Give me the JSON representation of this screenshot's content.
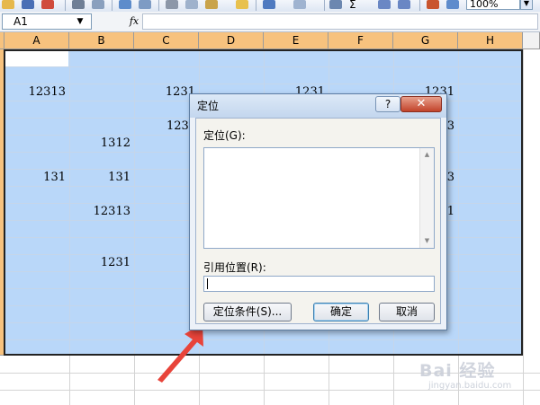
{
  "toolbar": {
    "zoom_value": "100%",
    "sigma_label": "Σ"
  },
  "formula_bar": {
    "name_box": "A1",
    "fx_label": "fx",
    "formula": ""
  },
  "sheet": {
    "columns": [
      "A",
      "B",
      "C",
      "D",
      "E",
      "F",
      "G",
      "H"
    ],
    "cells": {
      "a_row3": "12313",
      "c_row3": "1231",
      "e_row3": "1231",
      "g_row3": "1231",
      "c_row5": "123",
      "g_row5": "3",
      "b_row6": "1312",
      "a_row8": "131",
      "b_row8": "131",
      "g_row8": "3",
      "b_row10": "12313",
      "g_row10": "31",
      "b_row13": "1231"
    }
  },
  "dialog": {
    "title": "定位",
    "help_label": "?",
    "close_label": "✕",
    "goto_label": "定位(G):",
    "reference_label": "引用位置(R):",
    "reference_value": "",
    "special_button": "定位条件(S)...",
    "ok_button": "确定",
    "cancel_button": "取消"
  },
  "watermark": {
    "brand": "Bai 经验",
    "url": "jingyan.baidu.com"
  },
  "colors": {
    "column_header": "#f7c27e",
    "selection": "#b9d7f9",
    "arrow": "#e8443a"
  }
}
